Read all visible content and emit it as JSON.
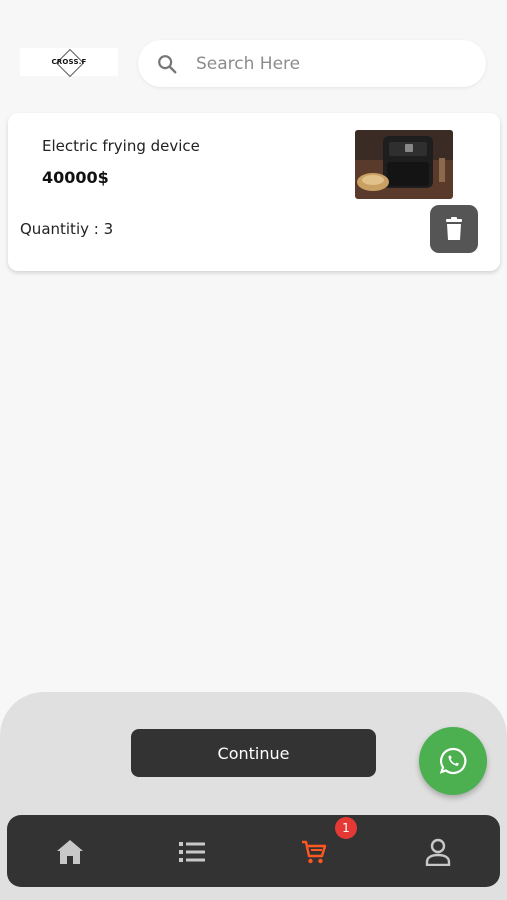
{
  "header": {
    "logo_text": "CROSS.F",
    "search_placeholder": "Search Here"
  },
  "cart": {
    "items": [
      {
        "name": "Electric frying device",
        "price": "40000$",
        "quantity_label": "Quantitiy : 3"
      }
    ]
  },
  "actions": {
    "continue_label": "Continue"
  },
  "nav": {
    "items": [
      "home-icon",
      "list-icon",
      "cart-icon",
      "profile-icon"
    ],
    "active": "cart-icon",
    "cart_badge": "1",
    "active_color": "#ff5722",
    "inactive_color": "#c8c8c8"
  },
  "colors": {
    "whatsapp": "#4caf50",
    "badge": "#e53935"
  }
}
